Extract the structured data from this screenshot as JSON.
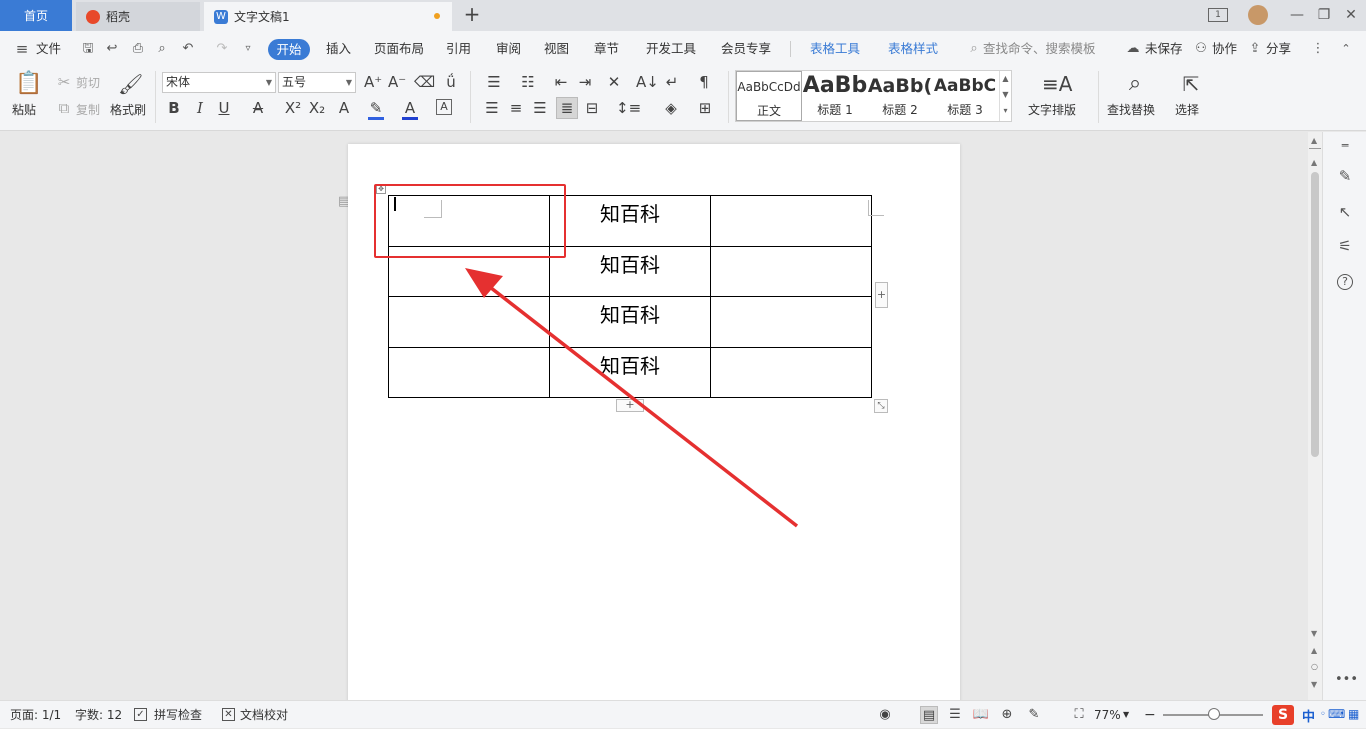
{
  "tabs": {
    "home": "首页",
    "daoke": "稻壳",
    "doc": "文字文稿1",
    "add": "+"
  },
  "menu": {
    "file": "文件",
    "start": "开始",
    "insert": "插入",
    "layout": "页面布局",
    "reference": "引用",
    "review": "审阅",
    "view": "视图",
    "chapter": "章节",
    "dev": "开发工具",
    "vip": "会员专享",
    "table_tools": "表格工具",
    "table_style": "表格样式",
    "search_placeholder": "查找命令、搜索模板",
    "unsaved": "未保存",
    "collab": "协作",
    "share": "分享"
  },
  "ribbon": {
    "paste": "粘贴",
    "cut": "剪切",
    "copy": "复制",
    "format_painter": "格式刷",
    "font_name": "宋体",
    "font_size": "五号",
    "styles": [
      {
        "preview": "AaBbCcDd",
        "label": "正文"
      },
      {
        "preview": "AaBb",
        "label": "标题 1"
      },
      {
        "preview": "AaBb(",
        "label": "标题 2"
      },
      {
        "preview": "AaBbC",
        "label": "标题 3"
      }
    ],
    "text_layout": "文字排版",
    "find_replace": "查找替换",
    "select": "选择"
  },
  "document": {
    "rows": [
      [
        "",
        "知百科",
        ""
      ],
      [
        "",
        "知百科",
        ""
      ],
      [
        "",
        "知百科",
        ""
      ],
      [
        "",
        "知百科",
        ""
      ]
    ]
  },
  "status": {
    "page": "页面: 1/1",
    "words": "字数: 12",
    "spell": "拼写检查",
    "proof": "文档校对",
    "zoom": "77%",
    "ime": "中"
  },
  "colors": {
    "accent": "#3a7bd5",
    "highlight": "#e53030",
    "arrow": "#e53030"
  }
}
